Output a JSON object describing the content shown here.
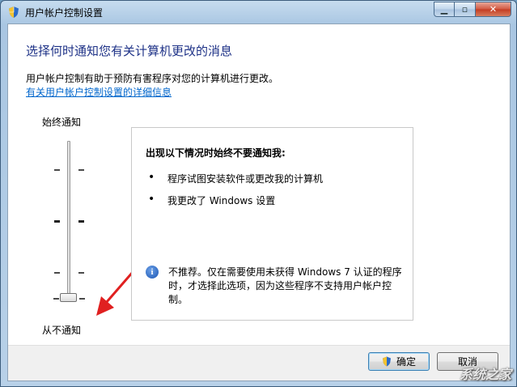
{
  "window": {
    "title": "用户帐户控制设置"
  },
  "main": {
    "heading": "选择何时通知您有关计算机更改的消息",
    "description": "用户帐户控制有助于预防有害程序对您的计算机进行更改。",
    "link": "有关用户帐户控制设置的详细信息"
  },
  "slider": {
    "top_label": "始终通知",
    "bottom_label": "从不通知",
    "level": 0,
    "levels": 4
  },
  "info": {
    "heading": "出现以下情况时始终不要通知我:",
    "bullets": [
      "程序试图安装软件或更改我的计算机",
      "我更改了 Windows 设置"
    ],
    "note": "不推荐。仅在需要使用未获得 Windows 7 认证的程序时，才选择此选项，因为这些程序不支持用户帐户控制。"
  },
  "buttons": {
    "ok": "确定",
    "cancel": "取消"
  },
  "watermark": "系统之家",
  "colors": {
    "heading": "#1e3287",
    "link": "#0066cc",
    "arrow": "#e02020"
  }
}
